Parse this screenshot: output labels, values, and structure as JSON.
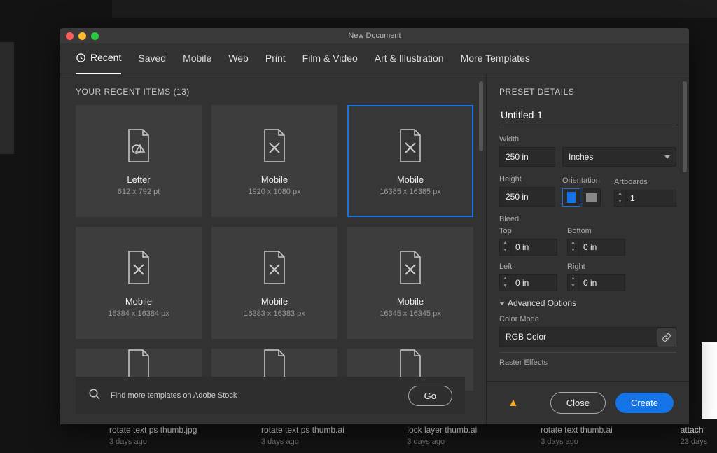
{
  "window": {
    "title": "New Document"
  },
  "tabs": [
    "Recent",
    "Saved",
    "Mobile",
    "Web",
    "Print",
    "Film & Video",
    "Art & Illustration",
    "More Templates"
  ],
  "recent": {
    "heading": "YOUR RECENT ITEMS  (13)",
    "items": [
      {
        "name": "Letter",
        "dim": "612 x 792 pt",
        "type": "shape"
      },
      {
        "name": "Mobile",
        "dim": "1920 x 1080 px",
        "type": "tools"
      },
      {
        "name": "Mobile",
        "dim": "16385 x 16385 px",
        "type": "tools",
        "selected": true
      },
      {
        "name": "Mobile",
        "dim": "16384 x 16384 px",
        "type": "tools"
      },
      {
        "name": "Mobile",
        "dim": "16383 x 16383 px",
        "type": "tools"
      },
      {
        "name": "Mobile",
        "dim": "16345 x 16345 px",
        "type": "tools"
      }
    ]
  },
  "stock": {
    "text": "Find more templates on Adobe Stock",
    "go": "Go"
  },
  "preset": {
    "heading": "PRESET DETAILS",
    "name": "Untitled-1",
    "width_label": "Width",
    "width": "250 in",
    "units": "Inches",
    "height_label": "Height",
    "height": "250 in",
    "orientation_label": "Orientation",
    "artboards_label": "Artboards",
    "artboards": "1",
    "bleed_label": "Bleed",
    "top_l": "Top",
    "top": "0 in",
    "bottom_l": "Bottom",
    "bottom": "0 in",
    "left_l": "Left",
    "left": "0 in",
    "right_l": "Right",
    "right": "0 in",
    "advanced": "Advanced Options",
    "color_mode_l": "Color Mode",
    "color_mode": "RGB Color",
    "raster_l": "Raster Effects"
  },
  "footer": {
    "close": "Close",
    "create": "Create"
  },
  "bg_files": [
    {
      "n": "rotate text ps thumb.jpg",
      "d": "3 days ago"
    },
    {
      "n": "rotate text ps thumb.ai",
      "d": "3 days ago"
    },
    {
      "n": "lock layer thumb.ai",
      "d": "3 days ago"
    },
    {
      "n": "rotate text thumb.ai",
      "d": "3 days ago"
    },
    {
      "n": "attach",
      "d": "23 days"
    }
  ]
}
